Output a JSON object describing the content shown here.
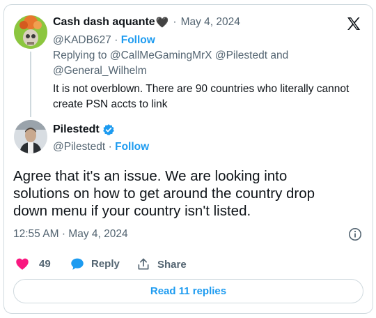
{
  "reply_tweet": {
    "author_name": "Cash dash aquante",
    "author_emoji": "🖤",
    "date": "May 4, 2024",
    "handle": "@KADB627",
    "follow_label": "Follow",
    "replying_prefix": "Replying to",
    "replying_to_1": "@CallMeGamingMrX",
    "replying_to_2": "@Pilestedt",
    "replying_and": "and",
    "replying_to_3": "@General_Wilhelm",
    "text_line1": "It is not overblown. There are 90 countries who literally cannot",
    "text_line2": "create PSN accts to link"
  },
  "main_tweet": {
    "author_name": "Pilestedt",
    "handle": "@Pilestedt",
    "follow_label": "Follow",
    "text_line1": "Agree that it's an issue. We are looking into",
    "text_line2": "solutions on how to get around the country drop",
    "text_line3": "down menu if your country isn't listed.",
    "time": "12:55 AM",
    "date": "May 4, 2024",
    "like_count": "49",
    "reply_label": "Reply",
    "share_label": "Share",
    "read_replies_label": "Read 11 replies"
  },
  "colors": {
    "accent": "#1d9bf0",
    "like": "#f91880",
    "muted": "#536471",
    "border": "#cfd9de"
  },
  "icons": [
    "x-logo-icon",
    "verified-badge-icon",
    "info-icon",
    "heart-icon",
    "reply-bubble-icon",
    "share-icon"
  ]
}
